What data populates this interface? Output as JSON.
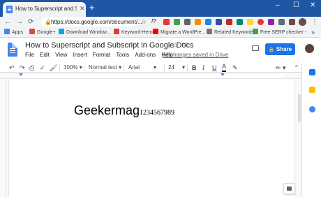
{
  "browser": {
    "tab_title": "How to Superscript and Subscript",
    "tab_close": "✕",
    "new_tab": "+",
    "window_controls": [
      "–",
      "☐",
      "✕"
    ],
    "nav": {
      "back": "←",
      "forward": "→",
      "reload": "⟳"
    },
    "url": "https://docs.google.com/document/...",
    "lock": "🔒",
    "extension_text": "f?"
  },
  "bookmarks": [
    {
      "label": "Apps",
      "icon": "apps-grid-icon",
      "color": "#4285f4"
    },
    {
      "label": "Google+",
      "icon": "google-plus-icon",
      "color": "#dd4b39"
    },
    {
      "label": "Download Window...",
      "icon": "windows-icon",
      "color": "#00a4ef"
    },
    {
      "label": "Keyword-Hero",
      "icon": "keyword-hero-icon",
      "color": "#e53935"
    },
    {
      "label": "Migrate a WordPre...",
      "icon": "youtube-icon",
      "color": "#ff0000"
    },
    {
      "label": "Related Keywords",
      "icon": "related-keywords-icon",
      "color": "#8d6e63"
    },
    {
      "label": "Free SERP checker -",
      "icon": "serp-icon",
      "color": "#43a047"
    }
  ],
  "bookmarks_more": "»",
  "docs": {
    "title": "How to Superscript and Subscript in Google Docs",
    "menus": [
      "File",
      "Edit",
      "View",
      "Insert",
      "Format",
      "Tools",
      "Add-ons",
      "Help"
    ],
    "saved_status": "All changes saved in Drive",
    "share_label": "Share",
    "share_icon": "🔒"
  },
  "toolbar": {
    "zoom": "100%",
    "style": "Normal text",
    "font": "Arial",
    "size": "24",
    "bold": "B",
    "italic": "I",
    "underline": "U",
    "text_color": "A"
  },
  "document": {
    "main_text": "Geekermag",
    "subscript_text": "1234567989"
  },
  "colors": {
    "accent": "#1a73e8",
    "tab_strip": "#1f57a5"
  }
}
